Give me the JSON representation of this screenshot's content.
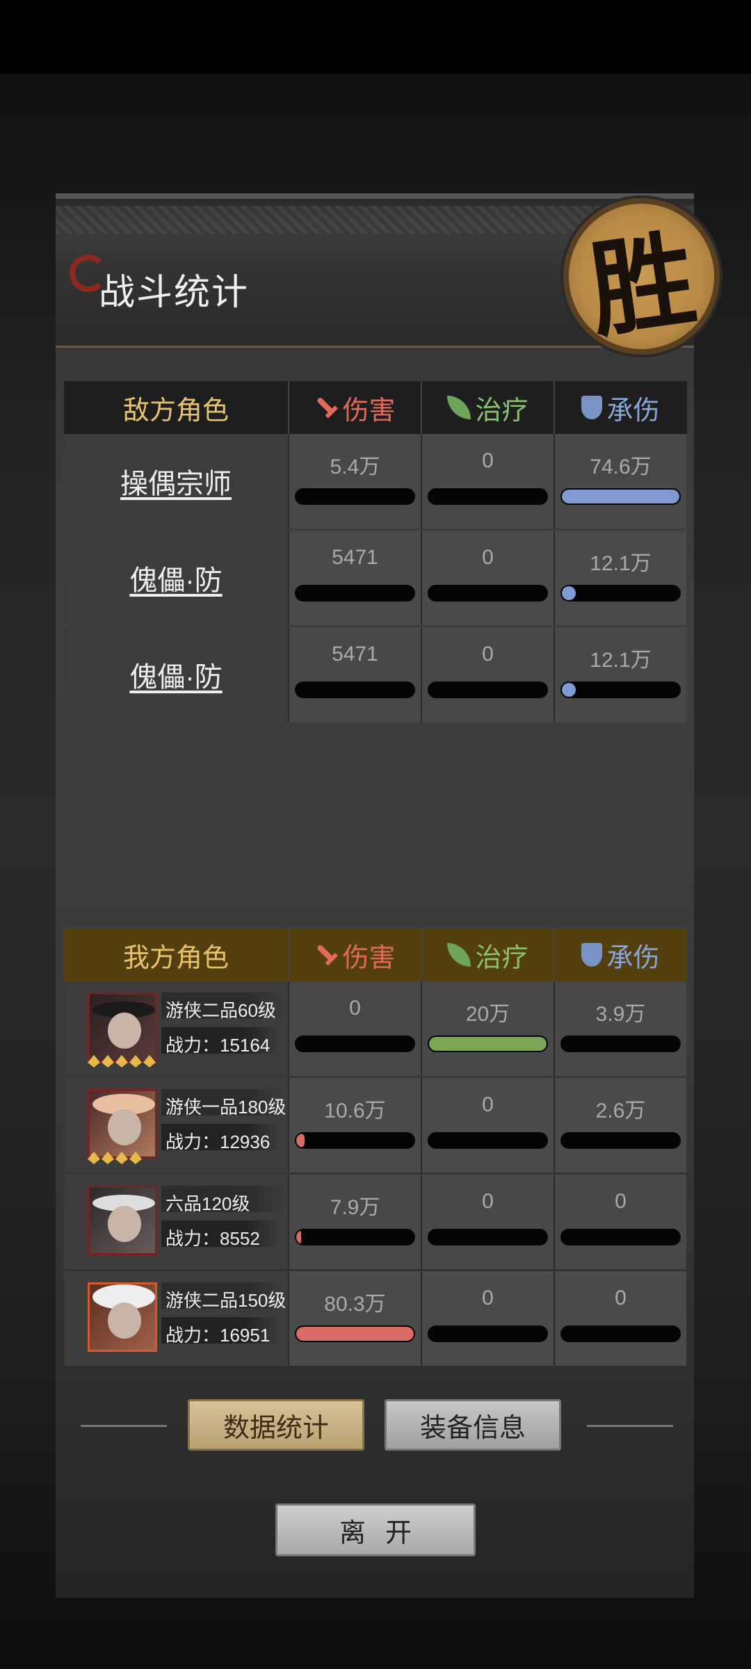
{
  "title": "战斗统计",
  "result_badge": "胜",
  "columns": {
    "damage": "伤害",
    "heal": "治疗",
    "taken": "承伤"
  },
  "enemy": {
    "header": "敌方角色",
    "rows": [
      {
        "name": "操偶宗师",
        "damage": "5.4万",
        "heal": "0",
        "taken": "74.6万",
        "damage_ratio": 0,
        "heal_ratio": 0,
        "taken_ratio": 1.0
      },
      {
        "name": "傀儡·防",
        "damage": "5471",
        "heal": "0",
        "taken": "12.1万",
        "damage_ratio": 0,
        "heal_ratio": 0,
        "taken_ratio": 0.12
      },
      {
        "name": "傀儡·防",
        "damage": "5471",
        "heal": "0",
        "taken": "12.1万",
        "damage_ratio": 0,
        "heal_ratio": 0,
        "taken_ratio": 0.12
      }
    ]
  },
  "ally": {
    "header": "我方角色",
    "rows": [
      {
        "title": "游侠二品60级",
        "power": "战力：15164",
        "stars": 5,
        "damage": "0",
        "heal": "20万",
        "taken": "3.9万",
        "damage_ratio": 0,
        "heal_ratio": 1.0,
        "taken_ratio": 0
      },
      {
        "title": "游侠一品180级",
        "power": "战力：12936",
        "stars": 4,
        "damage": "10.6万",
        "heal": "0",
        "taken": "2.6万",
        "damage_ratio": 0.07,
        "heal_ratio": 0,
        "taken_ratio": 0
      },
      {
        "title": "六品120级",
        "power": "战力：8552",
        "stars": 0,
        "damage": "7.9万",
        "heal": "0",
        "taken": "0",
        "damage_ratio": 0.04,
        "heal_ratio": 0,
        "taken_ratio": 0
      },
      {
        "title": "游侠二品150级",
        "power": "战力：16951",
        "stars": 0,
        "damage": "80.3万",
        "heal": "0",
        "taken": "0",
        "damage_ratio": 1.0,
        "heal_ratio": 0,
        "taken_ratio": 0
      }
    ]
  },
  "buttons": {
    "stats": "数据统计",
    "equipment": "装备信息",
    "leave": "离开"
  }
}
